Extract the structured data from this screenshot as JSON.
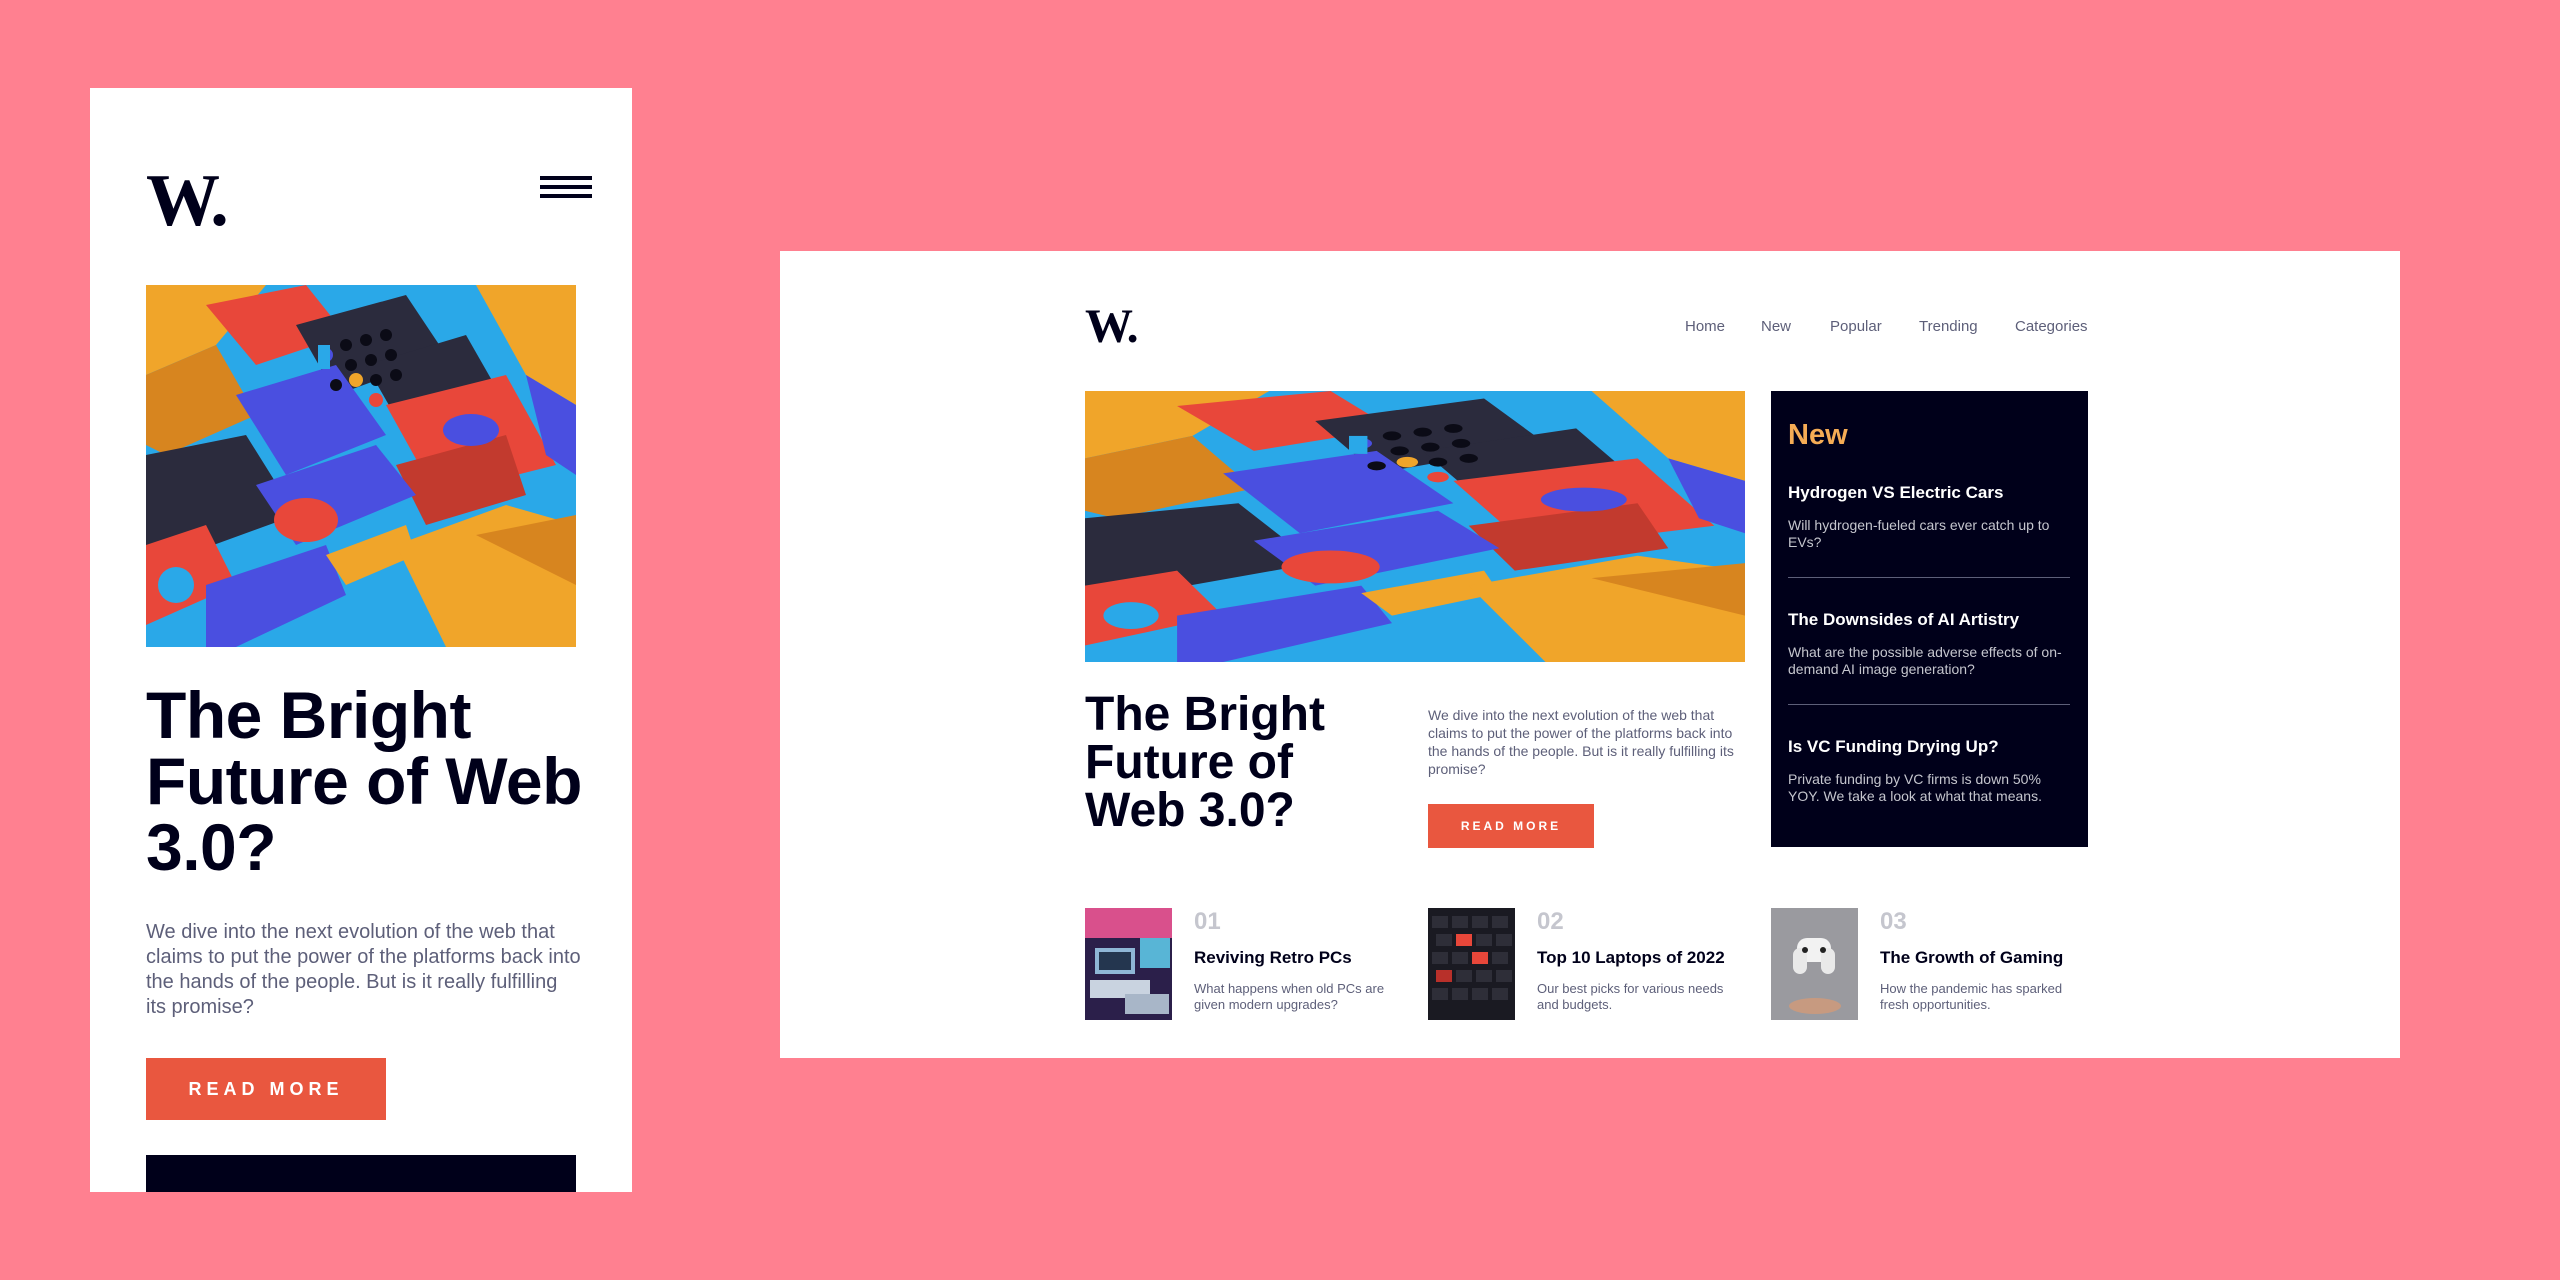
{
  "brand": {
    "logo": "W."
  },
  "colors": {
    "background": "#ff8090",
    "accent": "#e9573f",
    "dark": "#00001a",
    "highlight": "#f5ac55",
    "muted": "#5d5f79"
  },
  "mobile": {
    "menu_icon": "hamburger-icon",
    "hero_title": "The Bright Future of Web 3.0?",
    "hero_desc": "We dive into the next evolution of the web that claims to put the power of the platforms back into the hands of the people. But is it really fulfilling its promise?",
    "cta": "READ MORE"
  },
  "desktop": {
    "nav": [
      "Home",
      "New",
      "Popular",
      "Trending",
      "Categories"
    ],
    "hero_title": "The Bright Future of Web 3.0?",
    "hero_desc": "We dive into the next evolution of the web that claims to put the power of the platforms back into the hands of the people. But is it really fulfilling its promise?",
    "cta": "READ MORE",
    "new_section": {
      "title": "New",
      "items": [
        {
          "title": "Hydrogen VS Electric Cars",
          "desc": "Will hydrogen-fueled cars ever catch up to EVs?"
        },
        {
          "title": "The Downsides of AI Artistry",
          "desc": "What are the possible adverse effects of on-demand AI image generation?"
        },
        {
          "title": "Is VC Funding Drying Up?",
          "desc": "Private funding by VC firms is down 50% YOY. We take a look at what that means."
        }
      ]
    },
    "cards": [
      {
        "num": "01",
        "title": "Reviving Retro PCs",
        "desc": "What happens when old PCs are given modern upgrades?"
      },
      {
        "num": "02",
        "title": "Top 10 Laptops of 2022",
        "desc": "Our best picks for various needs and budgets."
      },
      {
        "num": "03",
        "title": "The Growth of Gaming",
        "desc": "How the pandemic has sparked fresh opportunities."
      }
    ]
  }
}
